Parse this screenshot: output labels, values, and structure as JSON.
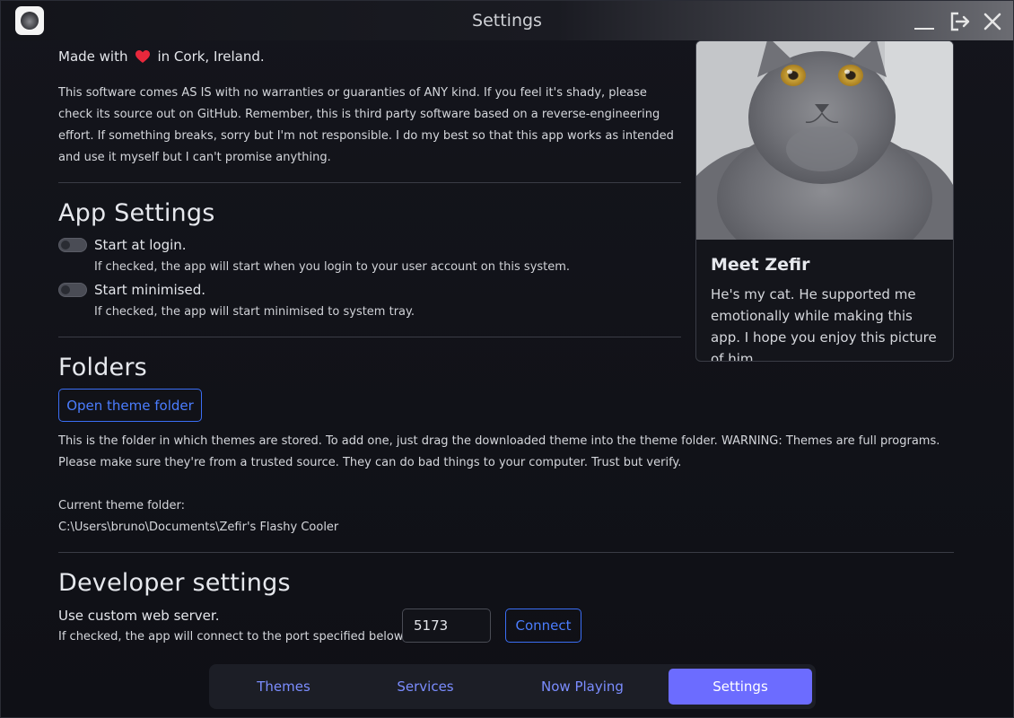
{
  "window": {
    "title": "Settings"
  },
  "about": {
    "made_with_prefix": "Made with",
    "made_with_suffix": "in Cork, Ireland.",
    "disclaimer": "This software comes AS IS with no warranties or guaranties of ANY kind. If you feel it's shady, please check its source out on GitHub. Remember, this is third party software based on a reverse-engineering effort. If something breaks, sorry but I'm not responsible. I do my best so that this app works as intended and use it myself but I can't promise anything."
  },
  "app_settings": {
    "heading": "App Settings",
    "start_at_login": {
      "label": "Start at login.",
      "help": "If checked, the app will start when you login to your user account on this system.",
      "checked": false
    },
    "start_minimised": {
      "label": "Start minimised.",
      "help": "If checked, the app will start minimised to system tray.",
      "checked": false
    }
  },
  "folders": {
    "heading": "Folders",
    "open_button": "Open theme folder",
    "description": "This is the folder in which themes are stored. To add one, just drag the downloaded theme into the theme folder. WARNING: Themes are full programs. Please make sure they're from a trusted source. They can do bad things to your computer. Trust but verify.",
    "current_label": "Current theme folder:",
    "current_path": "C:\\Users\\bruno\\Documents\\Zefir's Flashy Cooler"
  },
  "developer": {
    "heading": "Developer settings",
    "custom_server_label": "Use custom web server.",
    "custom_server_help": "If checked, the app will connect to the port specified below.",
    "port_value": "5173",
    "connect_button": "Connect"
  },
  "card": {
    "title": "Meet Zefir",
    "text": "He's my cat. He supported me emotionally while making this app. I hope you enjoy this picture of him."
  },
  "tabs": [
    {
      "label": "Themes",
      "active": false
    },
    {
      "label": "Services",
      "active": false
    },
    {
      "label": "Now Playing",
      "active": false
    },
    {
      "label": "Settings",
      "active": true
    }
  ],
  "colors": {
    "accent": "#6c6cff",
    "link_blue": "#4b7dff",
    "heart": "#e8283c",
    "background": "#121319"
  }
}
